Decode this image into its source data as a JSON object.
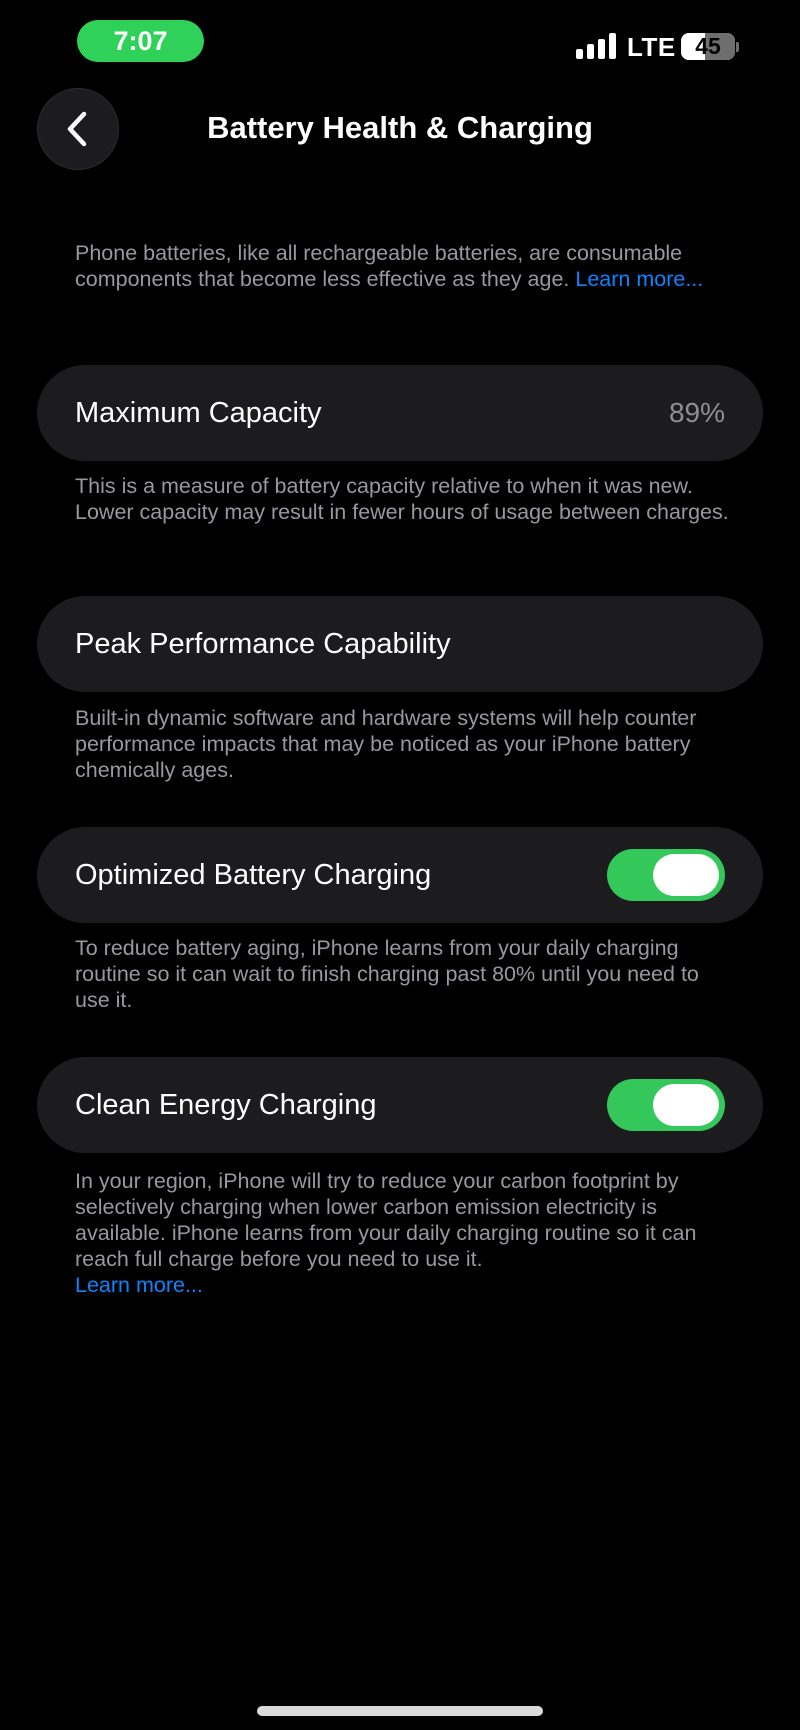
{
  "status_bar": {
    "time": "7:07",
    "time_pill_color": "#30d158",
    "carrier": "LTE",
    "battery_level": "45",
    "battery_fraction": 0.45,
    "signal_icon": "cellular-signal-icon"
  },
  "nav": {
    "title": "Battery Health & Charging",
    "back_icon": "chevron-left-icon"
  },
  "intro": {
    "text": "Phone batteries, like all rechargeable batteries, are consumable components that become less effective as they age.",
    "link": "Learn more..."
  },
  "cells": {
    "maximum_capacity": {
      "label": "Maximum Capacity",
      "value": "89%",
      "footer": "This is a measure of battery capacity relative to when it was new. Lower capacity may result in fewer hours of usage between charges."
    },
    "peak_performance": {
      "label": "Peak Performance Capability",
      "footer": "Built-in dynamic software and hardware systems will help counter performance impacts that may be noticed as your iPhone battery chemically ages."
    },
    "optimized_charging": {
      "label": "Optimized Battery Charging",
      "enabled": true,
      "footer": "To reduce battery aging, iPhone learns from your daily charging routine so it can wait to finish charging past 80% until you need to use it."
    },
    "clean_energy": {
      "label": "Clean Energy Charging",
      "enabled": true,
      "footer": "In your region, iPhone will try to reduce your carbon footprint by selectively charging when lower carbon emission electricity is available. iPhone learns from your daily charging routine so it can reach full charge before you need to use it.",
      "link": "Learn more..."
    }
  },
  "colors": {
    "background": "#000000",
    "cell_background": "#1c1c1e",
    "secondary_text": "#98989f",
    "link": "#0a84ff",
    "toggle_on": "#34c759"
  }
}
